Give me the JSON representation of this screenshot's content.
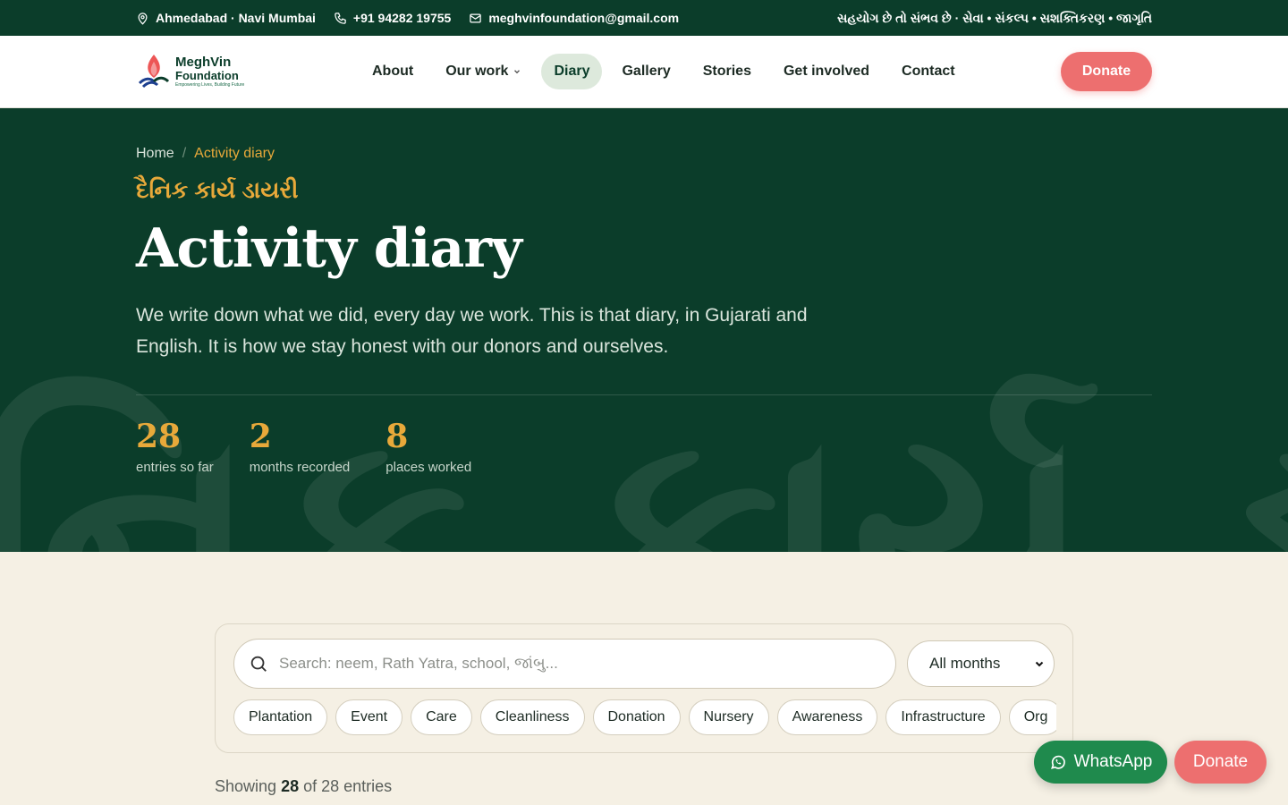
{
  "topbar": {
    "location": "Ahmedabad · Navi Mumbai",
    "phone": "+91 94282 19755",
    "email": "meghvinfoundation@gmail.com",
    "tagline": "સહયોગ છે તો સંભવ છે · સેવા • સંકલ્પ • સશક્તિકરણ • જાગૃતિ"
  },
  "logo": {
    "line1": "MeghVin",
    "line2": "Foundation",
    "line3": "Empowering Lives, Building Future"
  },
  "nav": {
    "items": [
      "About",
      "Our work",
      "Diary",
      "Gallery",
      "Stories",
      "Get involved",
      "Contact"
    ],
    "active": "Diary",
    "donate": "Donate"
  },
  "hero": {
    "breadcrumb": {
      "home": "Home",
      "sep": "/",
      "current": "Activity diary"
    },
    "gujarati_title": "દૈનિક કાર્ય ડાયરી",
    "title": "Activity diary",
    "description": "We write down what we did, every day we work. This is that diary, in Gujarati and English. It is how we stay honest with our donors and ourselves.",
    "background_text": "નિક કાર્ય ડાયરી",
    "stats": [
      {
        "value": "28",
        "label": "entries so far"
      },
      {
        "value": "2",
        "label": "months recorded"
      },
      {
        "value": "8",
        "label": "places worked"
      }
    ]
  },
  "filters": {
    "search_placeholder": "Search: neem, Rath Yatra, school, જાંબુ...",
    "month_selected": "All months",
    "chips": [
      "Plantation",
      "Event",
      "Care",
      "Cleanliness",
      "Donation",
      "Nursery",
      "Awareness",
      "Infrastructure",
      "Org"
    ]
  },
  "results": {
    "prefix": "Showing",
    "shown": "28",
    "suffix": "of 28 entries"
  },
  "floating": {
    "whatsapp": "WhatsApp",
    "donate": "Donate"
  },
  "colors": {
    "brand_green": "#0b3d2a",
    "accent_gold": "#e8a93a",
    "donate_coral": "#ed6f6f",
    "whatsapp_green": "#1f8a4d",
    "page_bg": "#f5f0e4"
  }
}
